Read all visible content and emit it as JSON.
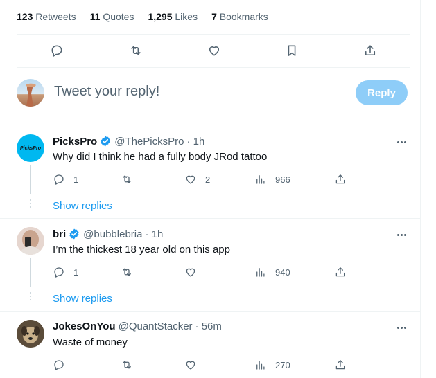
{
  "stats": {
    "retweets_count": "123",
    "retweets_label": "Retweets",
    "quotes_count": "11",
    "quotes_label": "Quotes",
    "likes_count": "1,295",
    "likes_label": "Likes",
    "bookmarks_count": "7",
    "bookmarks_label": "Bookmarks"
  },
  "actions": [
    "reply-icon",
    "retweet-icon",
    "like-icon",
    "bookmark-icon",
    "share-icon"
  ],
  "composer": {
    "placeholder": "Tweet your reply!",
    "reply_label": "Reply",
    "reply_color": "#8ecdf8"
  },
  "colors": {
    "accent": "#1d9bf0",
    "verified": "#1d9bf0",
    "muted": "#536471"
  },
  "tweets": [
    {
      "name": "PicksPro",
      "verified": true,
      "handle": "@ThePicksPro",
      "time": "· 1h",
      "text": "Why did I think he had a fully body JRod tattoo",
      "replies": "1",
      "likes": "2",
      "views": "966",
      "show_replies": "Show replies",
      "avatar_text": "PicksPro"
    },
    {
      "name": "bri",
      "verified": true,
      "handle": "@bubblebria",
      "time": "· 1h",
      "text": "I’m the thickest 18 year old on this app",
      "replies": "1",
      "likes": "",
      "views": "940",
      "show_replies": "Show replies"
    },
    {
      "name": "JokesOnYou",
      "verified": false,
      "handle": "@QuantStacker",
      "time": "· 56m",
      "text": "Waste of money",
      "replies": "",
      "likes": "",
      "views": "270"
    }
  ]
}
